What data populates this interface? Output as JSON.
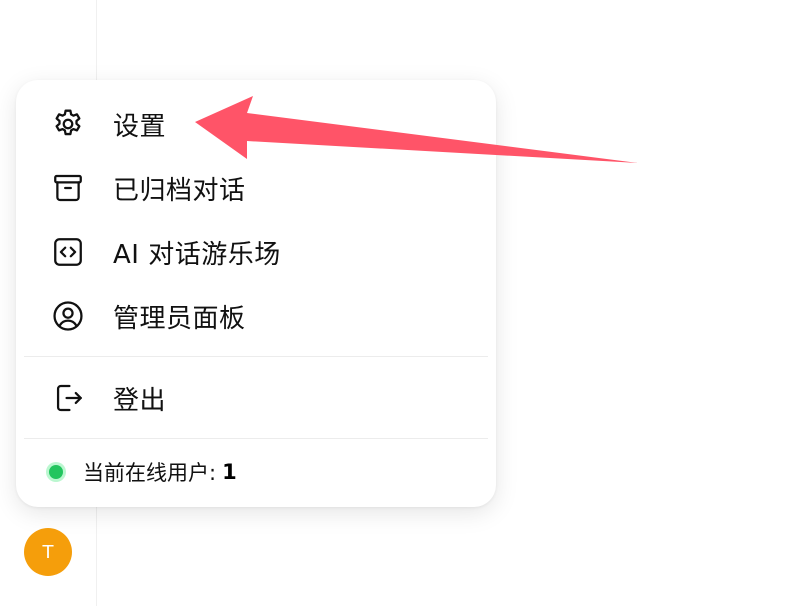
{
  "menu": {
    "items": [
      {
        "label": "设置",
        "icon": "gear-icon"
      },
      {
        "label": "已归档对话",
        "icon": "archive-icon"
      },
      {
        "label": "AI 对话游乐场",
        "icon": "code-icon"
      },
      {
        "label": "管理员面板",
        "icon": "user-circle-icon"
      }
    ],
    "logout": {
      "label": "登出",
      "icon": "logout-icon"
    },
    "status": {
      "label": "当前在线用户:",
      "count": "1",
      "dot_color": "#22c55e"
    }
  },
  "avatar": {
    "initial": "T",
    "color": "#f59e0b"
  },
  "annotation": {
    "arrow_color": "#ff5468"
  }
}
